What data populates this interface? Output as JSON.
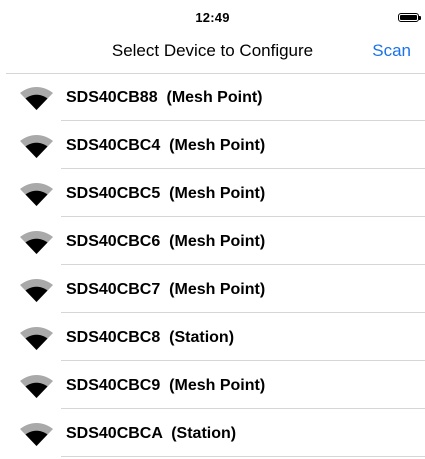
{
  "status_bar": {
    "time": "12:49"
  },
  "nav": {
    "title": "Select Device to Configure",
    "scan_label": "Scan"
  },
  "colors": {
    "accent": "#1a73e8",
    "signal_strong": "#000000",
    "signal_weak": "#a9a9a9"
  },
  "devices": [
    {
      "name": "SDS40CB88",
      "mode": "(Mesh Point)",
      "icon": "wifi-signal-icon"
    },
    {
      "name": "SDS40CBC4",
      "mode": "(Mesh Point)",
      "icon": "wifi-signal-icon"
    },
    {
      "name": "SDS40CBC5",
      "mode": "(Mesh Point)",
      "icon": "wifi-signal-icon"
    },
    {
      "name": "SDS40CBC6",
      "mode": "(Mesh Point)",
      "icon": "wifi-signal-icon"
    },
    {
      "name": "SDS40CBC7",
      "mode": "(Mesh Point)",
      "icon": "wifi-signal-icon"
    },
    {
      "name": "SDS40CBC8",
      "mode": "(Station)",
      "icon": "wifi-signal-icon"
    },
    {
      "name": "SDS40CBC9",
      "mode": "(Mesh Point)",
      "icon": "wifi-signal-icon"
    },
    {
      "name": "SDS40CBCA",
      "mode": "(Station)",
      "icon": "wifi-signal-icon"
    }
  ]
}
